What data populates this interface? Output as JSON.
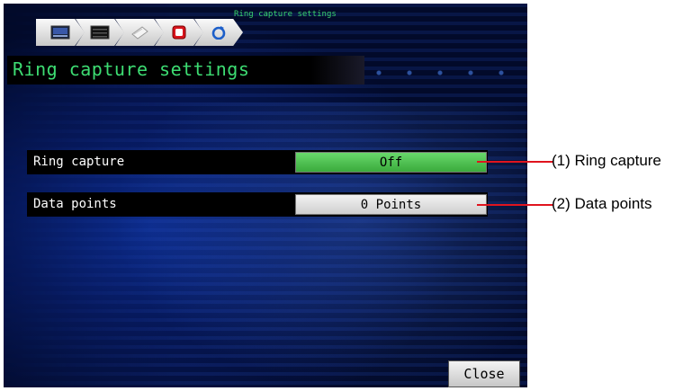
{
  "screen": {
    "breadcrumb_title": "Ring capture settings",
    "breadcrumb_icons": [
      "display-icon",
      "panel-icon",
      "paper-icon",
      "record-icon",
      "loop-icon"
    ],
    "page_title": "Ring capture settings",
    "settings": [
      {
        "label": "Ring capture",
        "value": "Off",
        "state_color": "#4cc24f"
      },
      {
        "label": "Data points",
        "value": "0 Points",
        "state_color": "#dcdcdc"
      }
    ],
    "close_label": "Close"
  },
  "annotations": [
    {
      "text": "(1) Ring capture",
      "color": "#e0141e"
    },
    {
      "text": "(2) Data points",
      "color": "#e0141e"
    }
  ]
}
